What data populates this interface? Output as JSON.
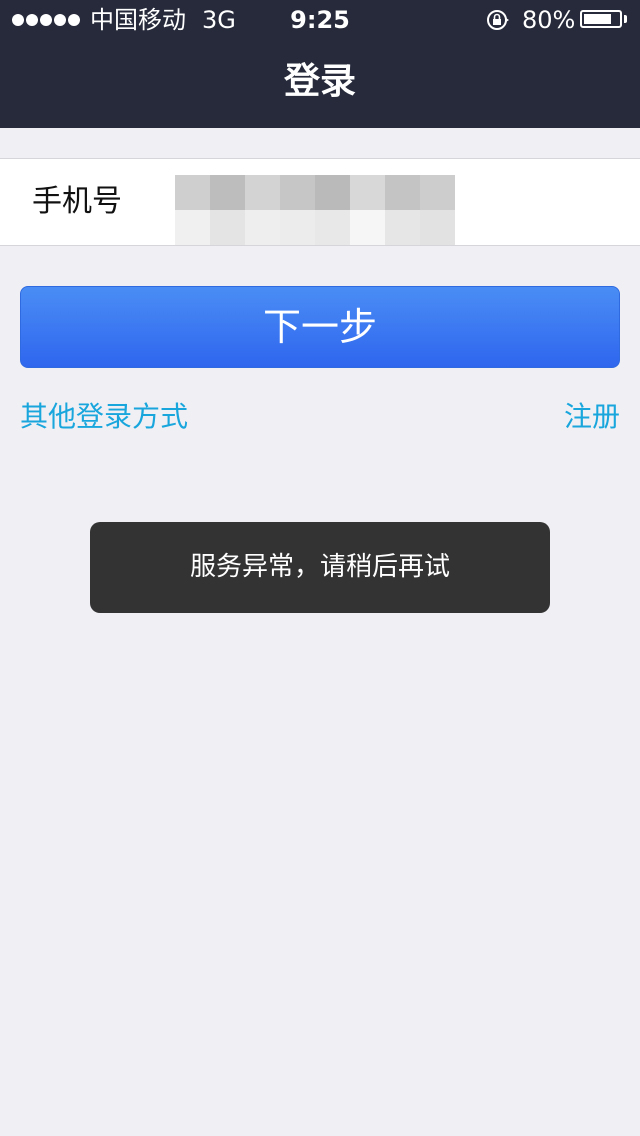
{
  "status_bar": {
    "carrier": "中国移动",
    "network": "3G",
    "time": "9:25",
    "battery": "80%",
    "battery_level": 0.8,
    "icons": [
      "signal-dots-icon",
      "orientation-lock-icon",
      "battery-icon"
    ]
  },
  "nav": {
    "title": "登录"
  },
  "form": {
    "phone_label": "手机号",
    "phone_value": ""
  },
  "actions": {
    "next_label": "下一步",
    "other_login": "其他登录方式",
    "register": "注册"
  },
  "toast": {
    "message": "服务异常，请稍后再试"
  },
  "colors": {
    "nav_background": "#262a3a",
    "page_background": "#efeff4",
    "button_gradient_top": "#4a8df5",
    "button_gradient_bottom": "#2f66ee",
    "link": "#19a6dd",
    "toast_background": "#333333"
  }
}
